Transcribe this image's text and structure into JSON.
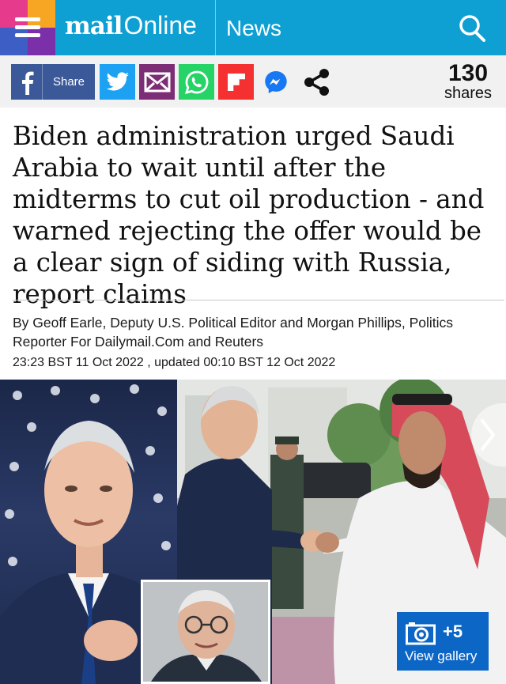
{
  "header": {
    "logo_mail": "mail",
    "logo_online": "Online",
    "section": "News"
  },
  "share": {
    "facebook_label": "Share",
    "count": "130",
    "count_label": "shares",
    "buttons": [
      "facebook",
      "twitter",
      "email",
      "whatsapp",
      "flipboard",
      "messenger",
      "share"
    ]
  },
  "article": {
    "headline": "Biden administration urged Saudi Arabia to wait until after the midterms to cut oil production - and warned rejecting the offer would be a clear sign of siding with Russia, report claims",
    "byline": "By Geoff Earle, Deputy U.S. Political Editor and Morgan Phillips, Politics Reporter For Dailymail.Com and Reuters",
    "date": "23:23 BST 11 Oct 2022 , updated 00:10 BST 12 Oct 2022"
  },
  "gallery": {
    "more_count": "+5",
    "label": "View gallery"
  },
  "colors": {
    "header_bg": "#0ea0d3",
    "facebook": "#3b5998",
    "twitter": "#1da1f2",
    "email": "#7d2d76",
    "whatsapp": "#25d366",
    "flipboard": "#f53030",
    "gallery_button": "#0b66c6"
  },
  "icons": [
    "menu-icon",
    "search-icon",
    "facebook-icon",
    "twitter-icon",
    "email-icon",
    "whatsapp-icon",
    "flipboard-icon",
    "messenger-icon",
    "share-icon",
    "camera-icon",
    "chevron-right-icon"
  ]
}
